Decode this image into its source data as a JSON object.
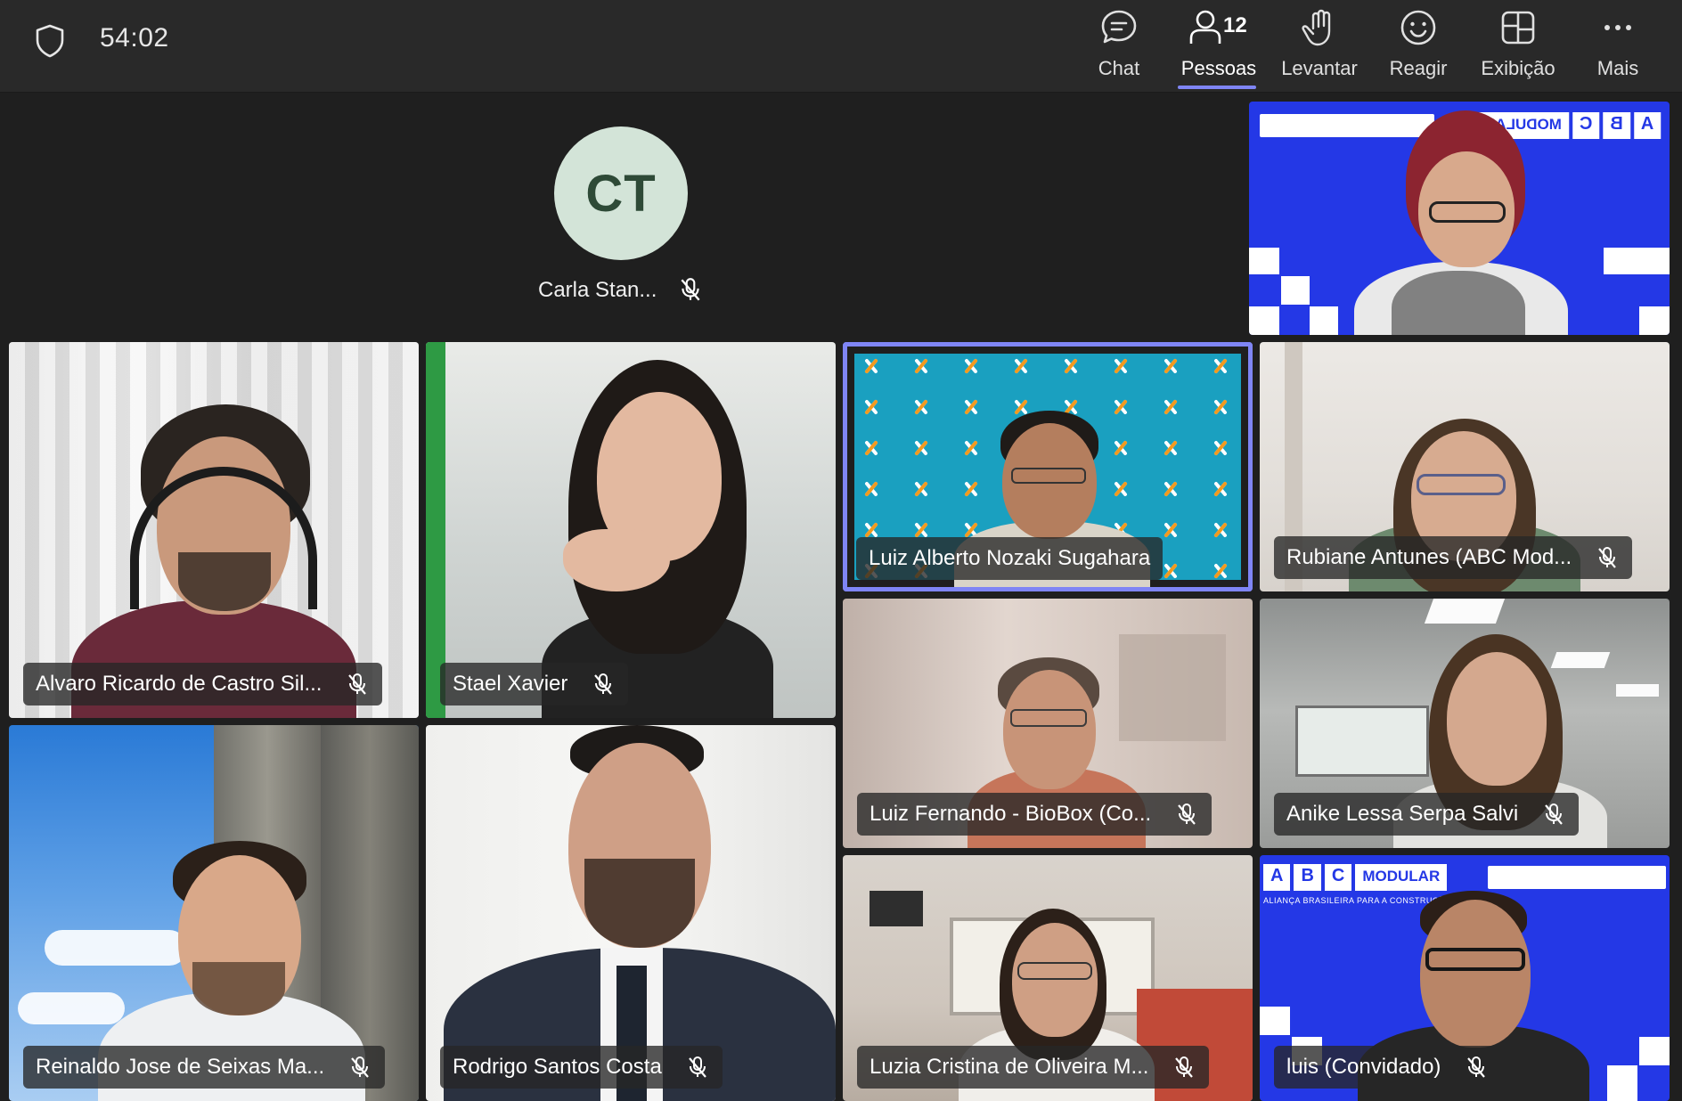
{
  "toolbar": {
    "timer": "54:02",
    "chat_label": "Chat",
    "people_label": "Pessoas",
    "people_count": "12",
    "raise_label": "Levantar",
    "react_label": "Reagir",
    "view_label": "Exibição",
    "more_label": "Mais"
  },
  "avatar_participant": {
    "initials": "CT",
    "name": "Carla Stan..."
  },
  "participants": {
    "alvaro": "Alvaro Ricardo de Castro Sil...",
    "stael": "Stael Xavier",
    "luiz_alberto": "Luiz Alberto Nozaki Sugahara",
    "rubiane": "Rubiane Antunes (ABC Mod...",
    "luiz_fernando": "Luiz Fernando - BioBox (Co...",
    "anike": "Anike Lessa Serpa Salvi",
    "reinaldo": "Reinaldo Jose de Seixas Ma...",
    "rodrigo": "Rodrigo Santos Costa",
    "luzia": "Luzia Cristina de Oliveira M...",
    "luis": "luis (Convidado)"
  },
  "banner": {
    "letters": [
      "A",
      "B",
      "C"
    ],
    "word": "MODULAR",
    "tagline": "ALIANÇA BRASILEIRA PARA A CONSTRUÇÃO MODULAR"
  },
  "colors": {
    "accent": "#7f85f5",
    "topbar": "#292929",
    "stage": "#1f1f1f",
    "banner_blue": "#2438e6",
    "teal_bg": "#1aa0c0",
    "avatar_bg": "#d3e4d8"
  }
}
